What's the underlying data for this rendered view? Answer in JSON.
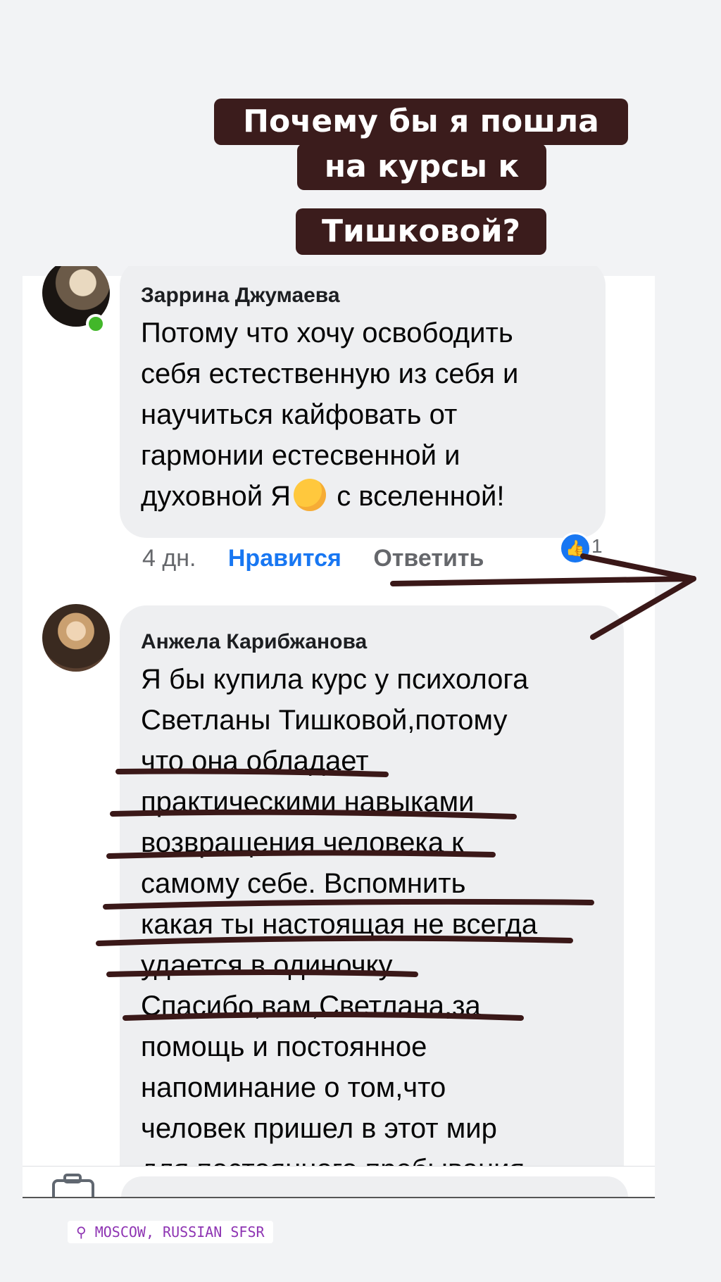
{
  "story_title": {
    "lines": [
      "Почему бы я пошла",
      "на курсы к",
      "Тишковой?"
    ],
    "background": "#3b1c1c"
  },
  "comments": [
    {
      "author": "Заррина Джумаева",
      "text_before_emoji": "Потому что хочу освободить\nсебя естественную из себя и\nнаучиться кайфовать от\nгармонии естесвенной и\nдуховной Я",
      "emoji": "kissing-face-icon",
      "text_after_emoji": " с вселенной!",
      "online": true,
      "time": "4 дн.",
      "like_label": "Нравится",
      "reply_label": "Ответить",
      "reaction_count": "1"
    },
    {
      "author": "Анжела Карибжанова",
      "text": "Я бы купила курс у психолога\nСветланы Тишковой,потому\nчто она обладает\nпрактическими навыками\nвозвращения человека к\nсамому себе.  Вспомнить\nкакая ты настоящая не всегда\nудается в одиночку.\nСпасибо,вам,Светлана,за\nпомощь и постоянное\nнапоминание о том,что\nчеловек пришел в этот мир\nдля постоянного пребывания"
    }
  ],
  "location_sticker": "MOSCOW, RUSSIAN SFSR",
  "colors": {
    "accent": "#1877f2",
    "marker": "#3a1818",
    "location": "#8e34b3"
  }
}
